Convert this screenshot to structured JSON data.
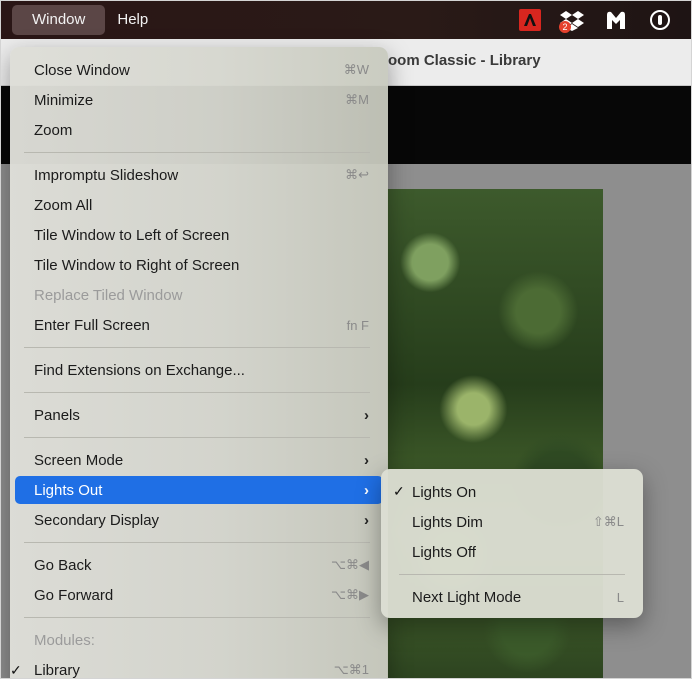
{
  "menubar": {
    "items": [
      "Window",
      "Help"
    ],
    "tray_icons": [
      "adobe-creative-cloud-icon",
      "dropbox-icon",
      "malwarebytes-icon",
      "onepassword-icon"
    ],
    "dropbox_badge": "2"
  },
  "window": {
    "title": "Lightroom Classic - Library",
    "title_visible": "oom Classic - Library"
  },
  "menu": {
    "items": [
      {
        "label": "Close Window",
        "shortcut": "⌘W"
      },
      {
        "label": "Minimize",
        "shortcut": "⌘M"
      },
      {
        "label": "Zoom",
        "shortcut": ""
      },
      {
        "label": "Impromptu Slideshow",
        "shortcut": "⌘↩"
      },
      {
        "label": "Zoom All",
        "shortcut": ""
      },
      {
        "label": "Tile Window to Left of Screen",
        "shortcut": ""
      },
      {
        "label": "Tile Window to Right of Screen",
        "shortcut": ""
      },
      {
        "label": "Replace Tiled Window",
        "shortcut": "",
        "disabled": true
      },
      {
        "label": "Enter Full Screen",
        "shortcut": "fn F"
      },
      {
        "label": "Find Extensions on Exchange...",
        "shortcut": ""
      },
      {
        "label": "Panels",
        "arrow": "›"
      },
      {
        "label": "Screen Mode",
        "arrow": "›"
      },
      {
        "label": "Lights Out",
        "arrow": "›",
        "highlighted": true
      },
      {
        "label": "Secondary Display",
        "arrow": "›"
      },
      {
        "label": "Go Back",
        "shortcut": "⌥⌘◀"
      },
      {
        "label": "Go Forward",
        "shortcut": "⌥⌘▶"
      },
      {
        "label": "Modules:",
        "disabled": true
      },
      {
        "label": "Library",
        "shortcut": "⌥⌘1",
        "checked": true
      }
    ],
    "check_mark": "✓"
  },
  "submenu": {
    "items": [
      {
        "label": "Lights On",
        "checked": true,
        "shortcut": ""
      },
      {
        "label": "Lights Dim",
        "shortcut": "⇧⌘L"
      },
      {
        "label": "Lights Off",
        "shortcut": ""
      },
      {
        "label": "Next Light Mode",
        "shortcut": "L"
      }
    ],
    "check_mark": "✓"
  },
  "colors": {
    "highlight": "#1f6fe5",
    "menubar": "#2a1616",
    "adobe_red": "#d7261f"
  }
}
